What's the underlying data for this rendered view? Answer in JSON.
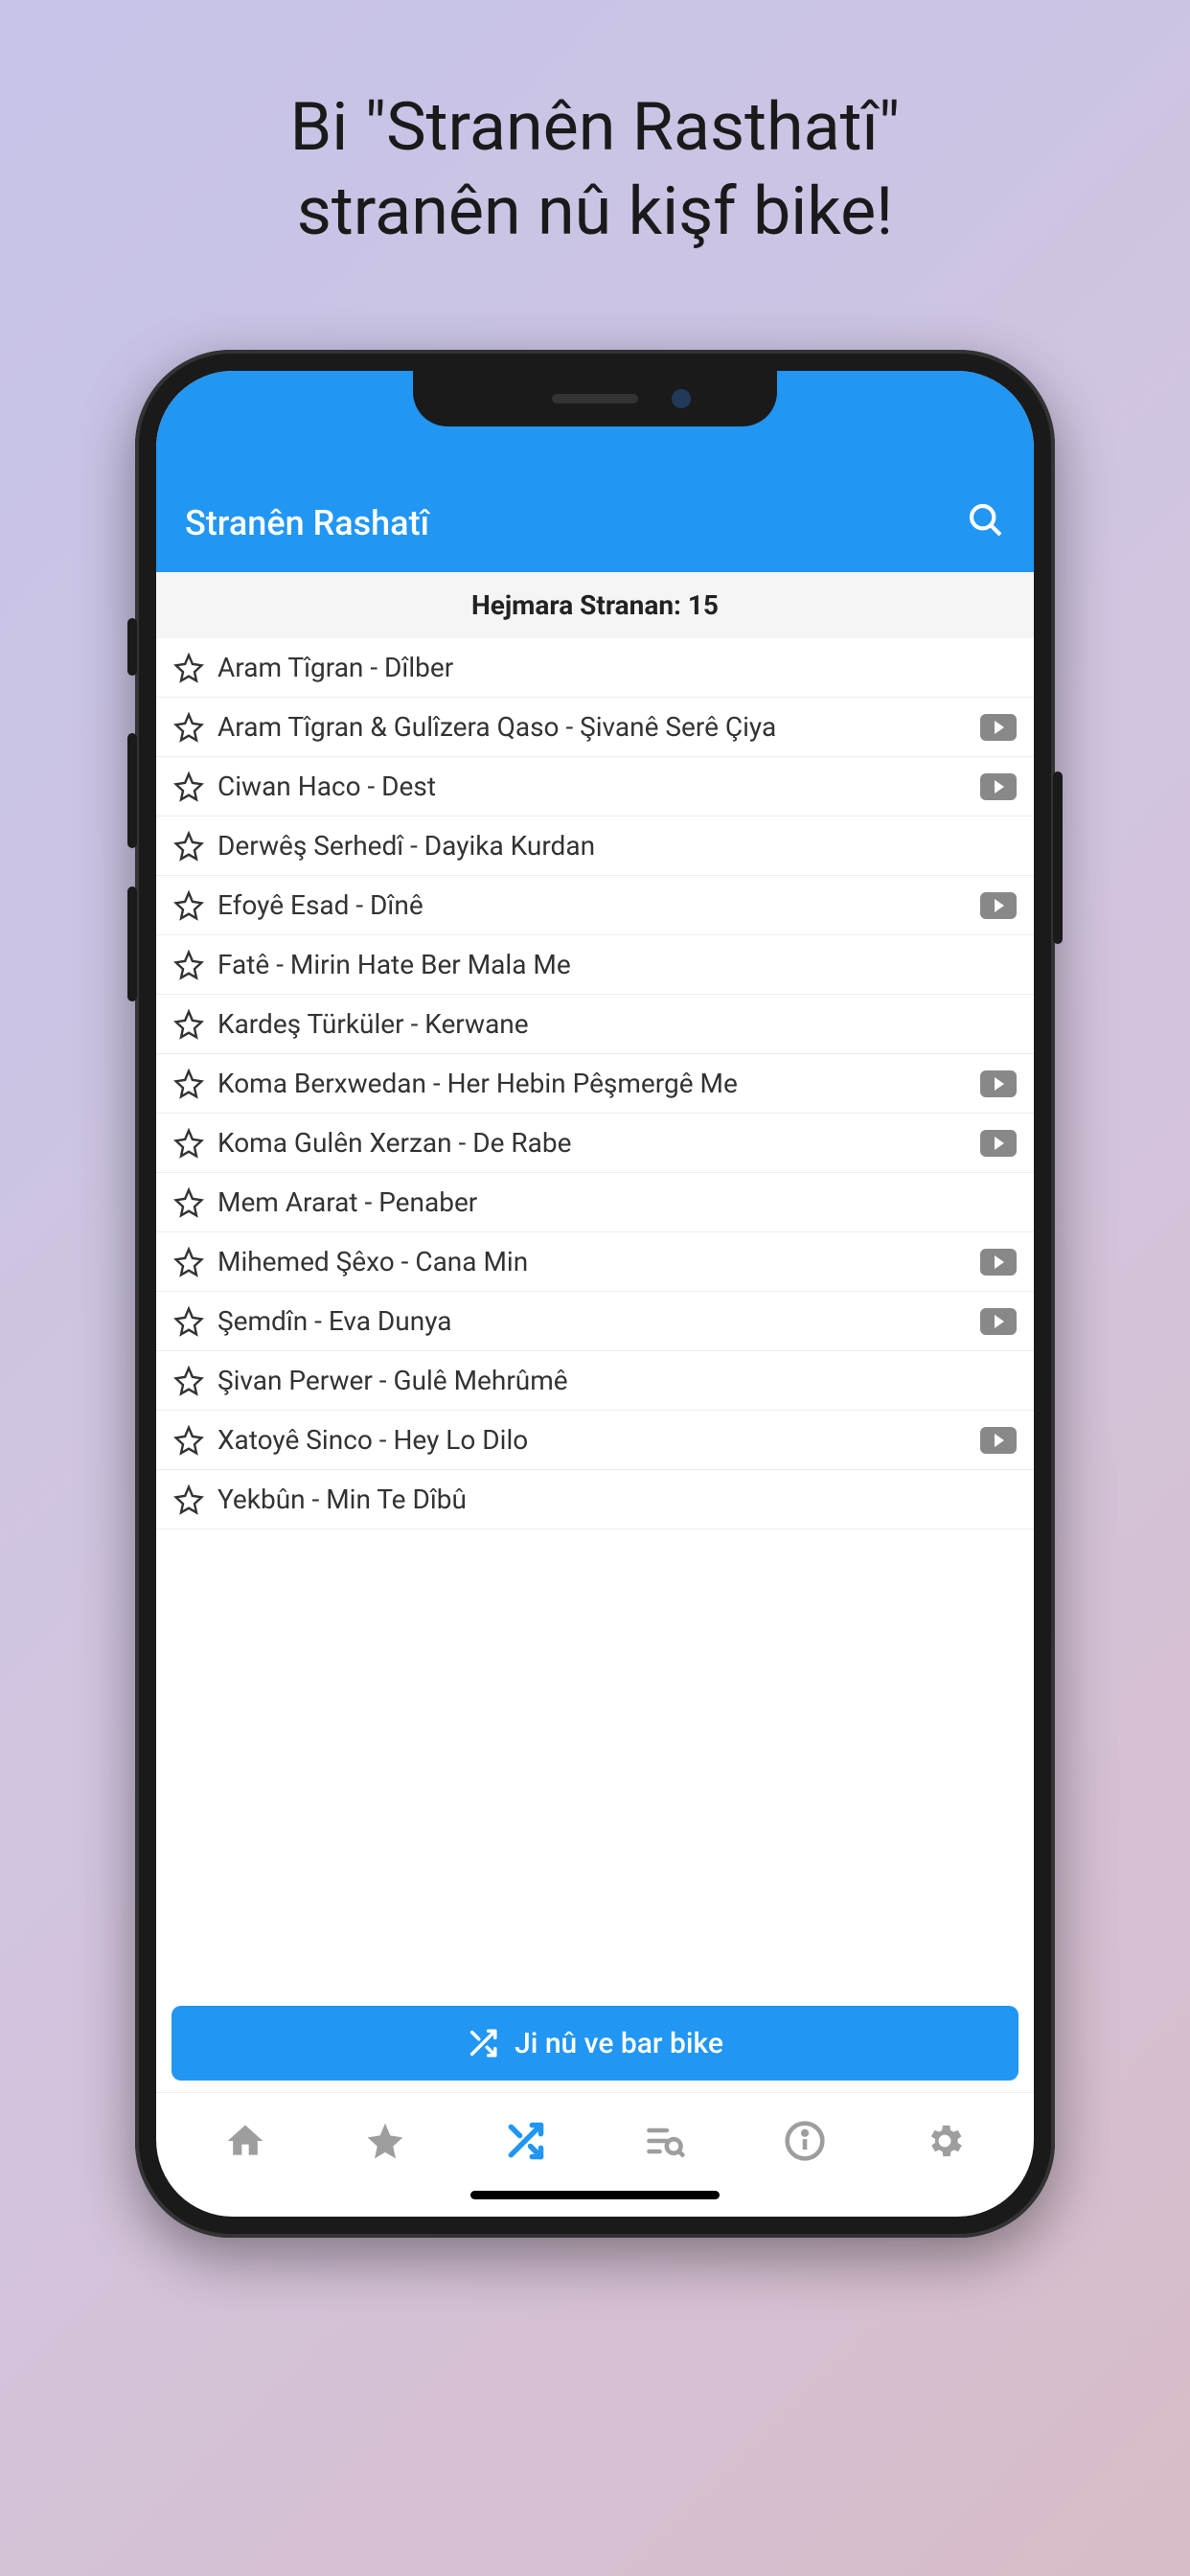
{
  "promo": {
    "line1": "Bi \"Stranên Rasthatî\"",
    "line2": "stranên nû kişf bike!"
  },
  "header": {
    "title": "Stranên Rashatî"
  },
  "count_label": "Hejmara Stranan: 15",
  "songs": [
    {
      "title": "Aram Tîgran - Dîlber",
      "starred": false,
      "has_video": false
    },
    {
      "title": "Aram Tîgran & Gulîzera Qaso - Şivanê Serê Çiya",
      "starred": false,
      "has_video": true
    },
    {
      "title": "Ciwan Haco - Dest",
      "starred": false,
      "has_video": true
    },
    {
      "title": "Derwêş Serhedî - Dayika Kurdan",
      "starred": false,
      "has_video": false
    },
    {
      "title": "Efoyê Esad - Dînê",
      "starred": false,
      "has_video": true
    },
    {
      "title": "Fatê - Mirin Hate Ber Mala Me",
      "starred": false,
      "has_video": false
    },
    {
      "title": "Kardeş Türküler - Kerwane",
      "starred": false,
      "has_video": false
    },
    {
      "title": "Koma Berxwedan - Her Hebin Pêşmergê Me",
      "starred": false,
      "has_video": true
    },
    {
      "title": "Koma Gulên Xerzan - De Rabe",
      "starred": false,
      "has_video": true
    },
    {
      "title": "Mem Ararat - Penaber",
      "starred": false,
      "has_video": false
    },
    {
      "title": "Mihemed Şêxo - Cana Min",
      "starred": false,
      "has_video": true
    },
    {
      "title": "Şemdîn - Eva Dunya",
      "starred": false,
      "has_video": true
    },
    {
      "title": "Şivan Perwer - Gulê Mehrûmê",
      "starred": false,
      "has_video": false
    },
    {
      "title": "Xatoyê Sinco - Hey Lo Dilo",
      "starred": false,
      "has_video": true
    },
    {
      "title": "Yekbûn - Min Te Dîbû",
      "starred": false,
      "has_video": false
    }
  ],
  "reload_button_label": "Ji nû ve bar bike",
  "nav": {
    "items": [
      "home",
      "favorites",
      "shuffle",
      "search-list",
      "info",
      "settings"
    ],
    "active_index": 2
  },
  "colors": {
    "primary": "#2196f3",
    "nav_inactive": "#9e9e9e",
    "nav_active": "#2196f3"
  }
}
